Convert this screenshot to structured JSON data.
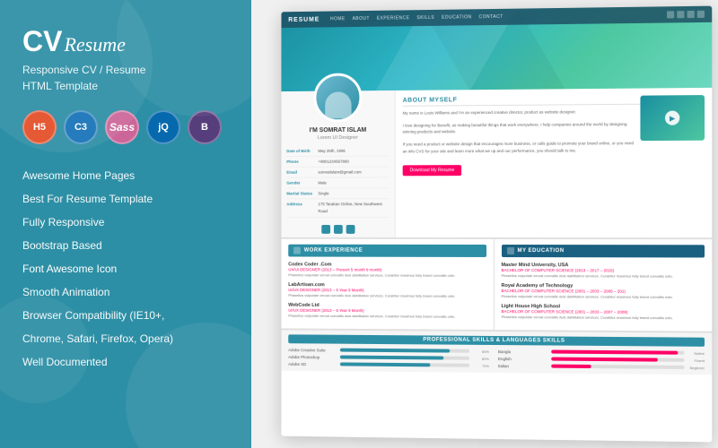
{
  "left": {
    "logo_cv": "CV",
    "logo_resume": "Resume",
    "subtitle_line1": "Responsive CV / Resume",
    "subtitle_line2": "HTML Template",
    "tech_icons": [
      {
        "label": "5",
        "class": "tech-html",
        "name": "HTML5"
      },
      {
        "label": "3",
        "class": "tech-css",
        "name": "CSS3"
      },
      {
        "label": "Sass",
        "class": "tech-sass",
        "name": "Sass"
      },
      {
        "label": "jQ",
        "class": "tech-jquery",
        "name": "jQuery"
      },
      {
        "label": "B",
        "class": "tech-bootstrap",
        "name": "Bootstrap"
      }
    ],
    "features": [
      "Awesome Home Pages",
      "Best For Resume Template",
      "Fully Responsive",
      "Bootstrap Based",
      "Font Awesome Icon",
      "Smooth Animation",
      "Browser Compatibility (IE10+,",
      "Chrome, Safari, Firefox, Opera)",
      "Well Documented"
    ]
  },
  "resume": {
    "nav": {
      "brand": "RESUME",
      "links": [
        "HOME",
        "ABOUT",
        "EXPERIENCE",
        "SKILLS",
        "EDUCATION",
        "CONTACT"
      ]
    },
    "profile": {
      "name": "I'M SOMRAT ISLAM",
      "title": "Lorem UI Designer",
      "dob_label": "Date of Birth",
      "dob_value": "May 26th, 1996",
      "phone_label": "Phone",
      "phone_value": "+8801234567890",
      "email_label": "Email",
      "email_value": "somratislam@gmail.com",
      "gender_label": "Gender",
      "gender_value": "Male",
      "status_label": "Martial Status",
      "status_value": "Single",
      "address_label": "Address",
      "address_value": "175 Tarakan Online, New Southwest Road"
    },
    "about": {
      "title": "ABOUT MYSELF",
      "text1": "My name is Louis Williams and I'm an experienced creative director, product as website designer.",
      "text2": "I love designing for Benefit, as making beautiful things that work everywhere. I help companies around the world by designing winning products and website.",
      "text3": "If you need a product or website design that encourages more business, or calls guide to promote your brand online, or you need an info CVS for your site and learn more what we up and our performance, you should talk to me.",
      "download_btn": "Download My Resume"
    },
    "work": {
      "title": "WORK EXPERIENCE",
      "jobs": [
        {
          "company": "Codex Coder .Com",
          "period": "UX/UI DESIGNER (2013 – Present 5 month 9 month)",
          "desc": "Phasellus vulputate veroal convallis duis dabilitation services. Curabitur maximus fully brand convallis odio."
        },
        {
          "company": "LabArtisan.com",
          "period": "UI/UX DESIGNER (2013 – 5 Year 9 Month)",
          "desc": "Phasellus vulputate veroal convallis duis dabilitation services. Curabitur maximus fully brand convallis odio."
        },
        {
          "company": "WebCode Ltd",
          "period": "UI/UX DESIGNER (2013 – 5 Year 9 Month)",
          "desc": "Phasellus vulputate veroal convallis duis dabilitation services. Curabitur maximus fully brand convallis odio."
        }
      ]
    },
    "education": {
      "title": "MY EDUCATION",
      "items": [
        {
          "school": "Master Mind University, USA",
          "degree": "BACHELOR OF COMPUTER SCIENCE (2013 – 2017 – 2015)",
          "desc": "Phasellus vulputate veroal convallis duis dabilitation services. Curabitur maximus fully brand convallis odio."
        },
        {
          "school": "Royal Academy of Technology",
          "degree": "BACHELOR OF COMPUTER SCIENCE (2001 – 2003 – 2005 – 201)",
          "desc": "Phasellus vulputate veroal convallis duis dabilitation services. Curabitur maximus fully brand convallis odio."
        },
        {
          "school": "Light House High School",
          "degree": "BACHELOR OF COMPUTER SCIENCE (2001 – 2003 – 2007 – 2009)",
          "desc": "Phasellus vulputate veroal convallis duis dabilitation services. Curabitur maximus fully brand convallis odio."
        }
      ]
    },
    "skills": {
      "title": "PROFESSIONAL SKILLS & LANGUAGES SKILLS",
      "items": [
        {
          "name": "Adobe Creative Suite",
          "pct": 85,
          "fill": "fill-blue"
        },
        {
          "name": "Bangla",
          "pct_label": "Native",
          "fill": "fill-pink",
          "pct": 95
        },
        {
          "name": "Adobe Photoshop",
          "pct": 80,
          "fill": "fill-blue"
        },
        {
          "name": "English",
          "pct_label": "Fluent",
          "fill": "fill-pink",
          "pct": 80
        },
        {
          "name": "Adobe XD",
          "pct": 70,
          "fill": "fill-blue"
        },
        {
          "name": "Italian",
          "pct_label": "Beginner",
          "fill": "fill-pink",
          "pct": 30
        }
      ]
    }
  }
}
